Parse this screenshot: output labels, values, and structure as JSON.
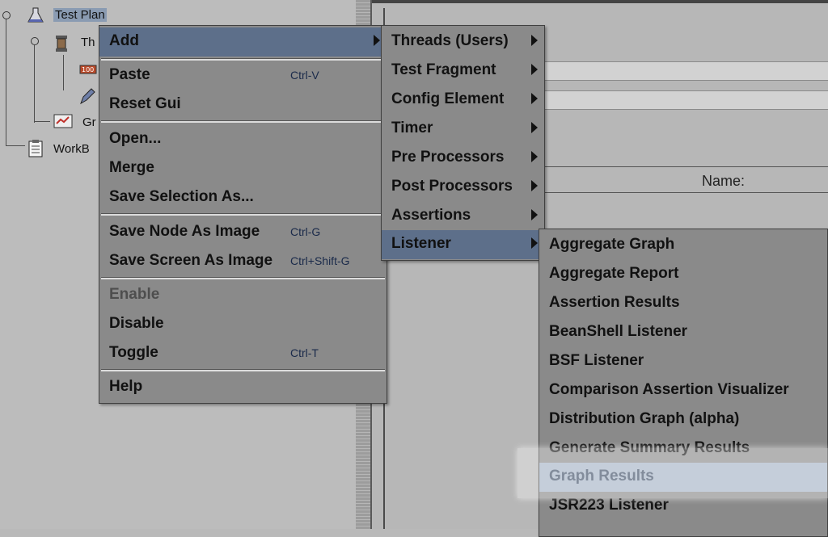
{
  "tree": {
    "items": [
      {
        "label": "Test Plan",
        "icon": "flask-icon"
      },
      {
        "label": "Th",
        "icon": "spool-icon"
      },
      {
        "label": "",
        "icon": "sampler-icon"
      },
      {
        "label": "",
        "icon": "pencil-icon"
      },
      {
        "label": "Gr",
        "icon": "graph-icon"
      },
      {
        "label": "WorkB",
        "icon": "clipboard-icon"
      }
    ]
  },
  "right": {
    "name_label": "Name:"
  },
  "context_menu": {
    "items": [
      {
        "label": "Add",
        "has_submenu": true
      },
      {
        "label": "Paste",
        "shortcut": "Ctrl-V"
      },
      {
        "label": "Reset Gui"
      },
      {
        "label": "Open..."
      },
      {
        "label": "Merge"
      },
      {
        "label": "Save Selection As..."
      },
      {
        "label": "Save Node As Image",
        "shortcut": "Ctrl-G"
      },
      {
        "label": "Save Screen As Image",
        "shortcut": "Ctrl+Shift-G"
      },
      {
        "label": "Enable",
        "disabled": true
      },
      {
        "label": "Disable"
      },
      {
        "label": "Toggle",
        "shortcut": "Ctrl-T"
      },
      {
        "label": "Help"
      }
    ]
  },
  "add_submenu": {
    "items": [
      {
        "label": "Threads (Users)"
      },
      {
        "label": "Test Fragment"
      },
      {
        "label": "Config Element"
      },
      {
        "label": "Timer"
      },
      {
        "label": "Pre Processors"
      },
      {
        "label": "Post Processors"
      },
      {
        "label": "Assertions"
      },
      {
        "label": "Listener"
      }
    ]
  },
  "listener_submenu": {
    "items": [
      {
        "label": "Aggregate Graph"
      },
      {
        "label": "Aggregate Report"
      },
      {
        "label": "Assertion Results"
      },
      {
        "label": "BeanShell Listener"
      },
      {
        "label": "BSF Listener"
      },
      {
        "label": "Comparison Assertion Visualizer"
      },
      {
        "label": "Distribution Graph (alpha)"
      },
      {
        "label": "Generate Summary Results"
      },
      {
        "label": "Graph Results"
      },
      {
        "label": "JSR223 Listener"
      }
    ]
  }
}
